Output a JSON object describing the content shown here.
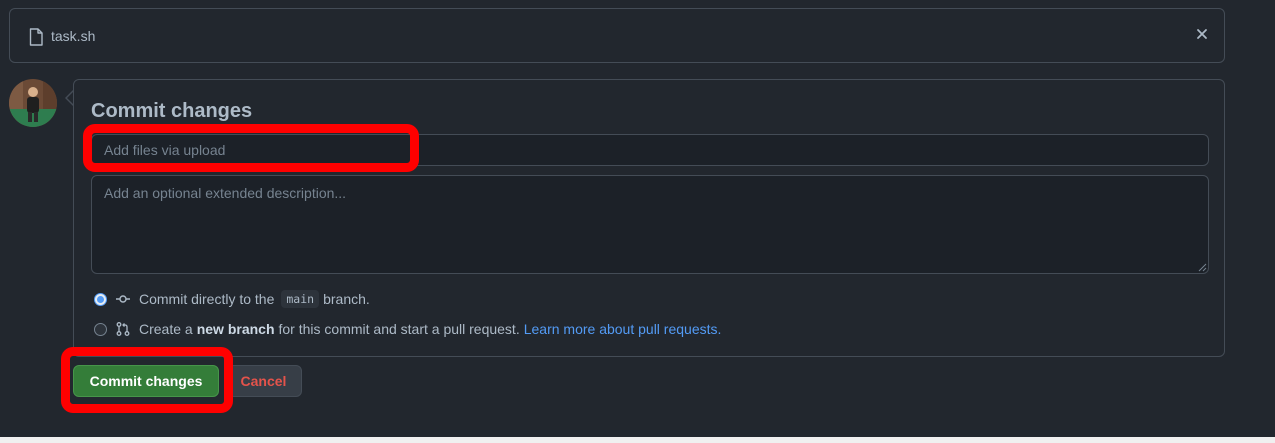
{
  "file": {
    "name": "task.sh",
    "icon": "file-icon",
    "close_icon": "close-icon"
  },
  "avatar": {
    "icon": "user-avatar"
  },
  "commit_panel": {
    "title": "Commit changes",
    "summary_placeholder": "Add files via upload",
    "summary_value": "",
    "description_placeholder": "Add an optional extended description...",
    "description_value": "",
    "options": [
      {
        "id": "direct",
        "checked": true,
        "icon": "git-commit-icon",
        "text_before": "Commit directly to the",
        "branch": "main",
        "text_after": "branch."
      },
      {
        "id": "new-branch",
        "checked": false,
        "icon": "git-pull-request-icon",
        "text_before": "Create a",
        "bold": "new branch",
        "text_after": "for this commit and start a pull request.",
        "link": "Learn more about pull requests."
      }
    ]
  },
  "buttons": {
    "commit_label": "Commit changes",
    "cancel_label": "Cancel"
  },
  "colors": {
    "background": "#22272e",
    "border": "#444c56",
    "primary_button": "#347d39",
    "cancel_text": "#e5534b",
    "link": "#539bf5",
    "annotation": "#ff0000"
  }
}
